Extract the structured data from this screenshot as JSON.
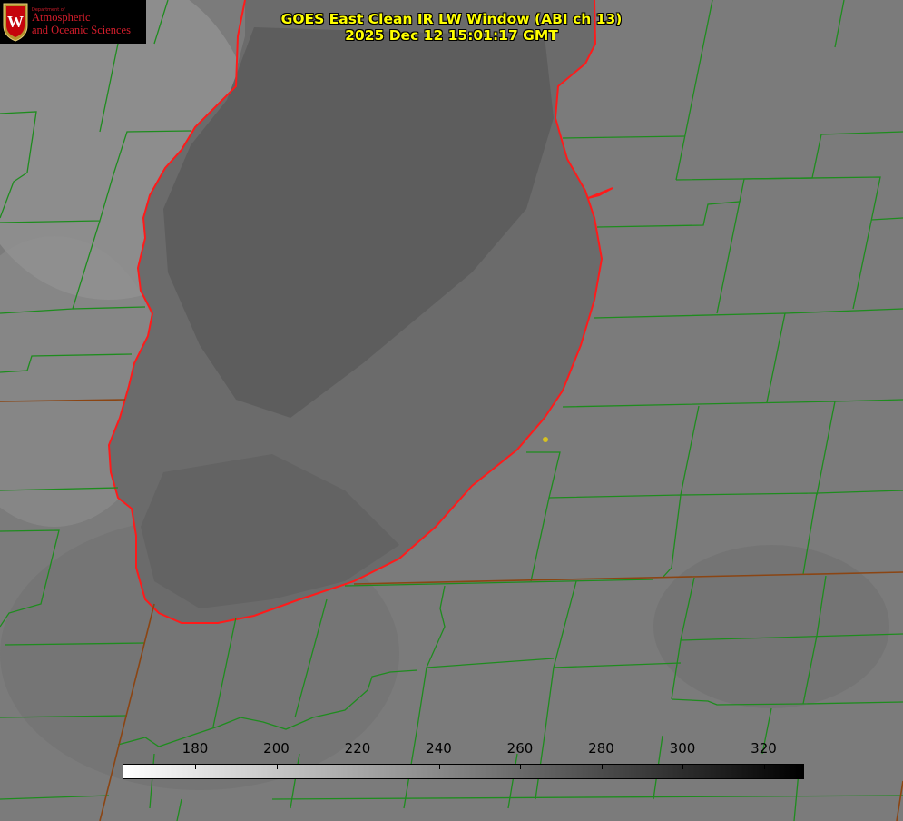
{
  "logo": {
    "small": "Department of",
    "line1": "Atmospheric",
    "line2": "and Oceanic Sciences"
  },
  "title": {
    "line1": "GOES East Clean IR LW Window (ABI ch 13)",
    "line2": "2025 Dec 12 15:01:17 GMT"
  },
  "colorbar": {
    "ticks": [
      "180",
      "200",
      "220",
      "240",
      "260",
      "280",
      "300",
      "320"
    ],
    "gradient_start": "#ffffff",
    "gradient_end": "#000000"
  },
  "colors": {
    "title": "#ffff00",
    "lake_outline": "#ff1a1a",
    "county_lines": "#1e8c1e",
    "state_lines": "#8b4513",
    "point_marker": "#d7c21f",
    "logo_text": "#d21d2b"
  }
}
